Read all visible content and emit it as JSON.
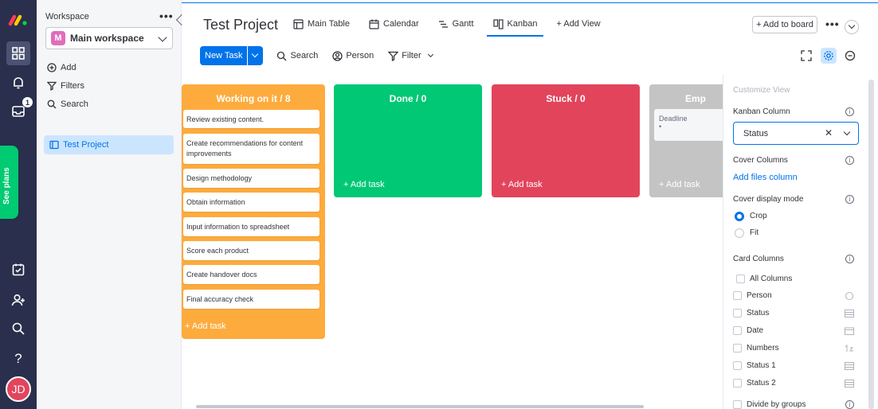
{
  "sidebar_rail": {
    "inbox_badge": "1",
    "see_plans": "See plans",
    "avatar_initials": "JD"
  },
  "workspace": {
    "label": "Workspace",
    "selected": "Main workspace",
    "selected_initial": "M",
    "actions": [
      "Add",
      "Filters",
      "Search"
    ],
    "project": "Test Project"
  },
  "header": {
    "title": "Test Project",
    "tabs": [
      {
        "label": "Main Table",
        "icon": "table-icon"
      },
      {
        "label": "Calendar",
        "icon": "calendar-icon"
      },
      {
        "label": "Gantt",
        "icon": "gantt-icon"
      },
      {
        "label": "Kanban",
        "icon": "kanban-icon",
        "active": true
      },
      {
        "label": "+ Add View",
        "icon": ""
      }
    ],
    "add_to_board": "+ Add to board"
  },
  "toolbar": {
    "new_task": "New Task",
    "search": "Search",
    "person": "Person",
    "filter": "Filter"
  },
  "board": {
    "columns": [
      {
        "title": "Working on it / 8",
        "color": "#fdab3d",
        "cards": [
          "Review existing content.",
          "Create recommendations for content improvements",
          "Design methodology",
          "Obtain information",
          "Input information to spreadsheet",
          "Score each product",
          "Create handover docs",
          "Final accuracy check"
        ],
        "add": "+ Add task"
      },
      {
        "title": "Done / 0",
        "color": "#00c875",
        "cards": [],
        "add": "+ Add task"
      },
      {
        "title": "Stuck / 0",
        "color": "#e2445c",
        "cards": [],
        "add": "+ Add task"
      },
      {
        "title": "Emp",
        "color": "#c4c4c4",
        "card_label": "Deadline",
        "card_dot": "•",
        "add": "+ Add task"
      }
    ]
  },
  "customize": {
    "heading": "Customize View",
    "kanban_column_label": "Kanban Column",
    "kanban_column_value": "Status",
    "cover_columns_label": "Cover Columns",
    "add_files_column": "Add files column",
    "cover_display_mode_label": "Cover display mode",
    "modes": [
      "Crop",
      "Fit"
    ],
    "selected_mode": "Crop",
    "card_columns_label": "Card Columns",
    "card_columns": [
      "All Columns",
      "Person",
      "Status",
      "Date",
      "Numbers",
      "Status 1",
      "Status 2"
    ],
    "divide_by_groups": "Divide by groups"
  }
}
